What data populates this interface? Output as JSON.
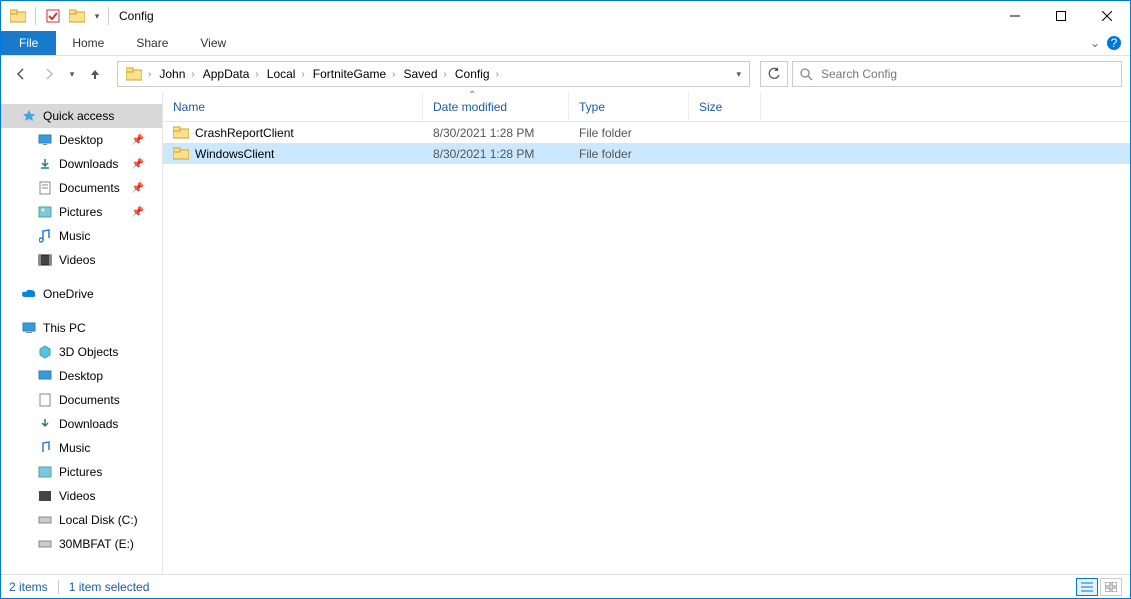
{
  "window": {
    "title": "Config"
  },
  "ribbon": {
    "file": "File",
    "tabs": [
      "Home",
      "Share",
      "View"
    ]
  },
  "breadcrumbs": [
    "John",
    "AppData",
    "Local",
    "FortniteGame",
    "Saved",
    "Config"
  ],
  "search": {
    "placeholder": "Search Config"
  },
  "sidebar": {
    "quick_access": {
      "label": "Quick access",
      "items": [
        {
          "label": "Desktop",
          "pinned": true
        },
        {
          "label": "Downloads",
          "pinned": true
        },
        {
          "label": "Documents",
          "pinned": true
        },
        {
          "label": "Pictures",
          "pinned": true
        },
        {
          "label": "Music",
          "pinned": false
        },
        {
          "label": "Videos",
          "pinned": false
        }
      ]
    },
    "onedrive": {
      "label": "OneDrive"
    },
    "this_pc": {
      "label": "This PC",
      "items": [
        {
          "label": "3D Objects"
        },
        {
          "label": "Desktop"
        },
        {
          "label": "Documents"
        },
        {
          "label": "Downloads"
        },
        {
          "label": "Music"
        },
        {
          "label": "Pictures"
        },
        {
          "label": "Videos"
        },
        {
          "label": "Local Disk (C:)"
        },
        {
          "label": "30MBFAT (E:)"
        }
      ]
    }
  },
  "columns": {
    "name": "Name",
    "date": "Date modified",
    "type": "Type",
    "size": "Size"
  },
  "rows": [
    {
      "name": "CrashReportClient",
      "date": "8/30/2021 1:28 PM",
      "type": "File folder",
      "size": "",
      "selected": false
    },
    {
      "name": "WindowsClient",
      "date": "8/30/2021 1:28 PM",
      "type": "File folder",
      "size": "",
      "selected": true
    }
  ],
  "status": {
    "items": "2 items",
    "selected": "1 item selected"
  }
}
